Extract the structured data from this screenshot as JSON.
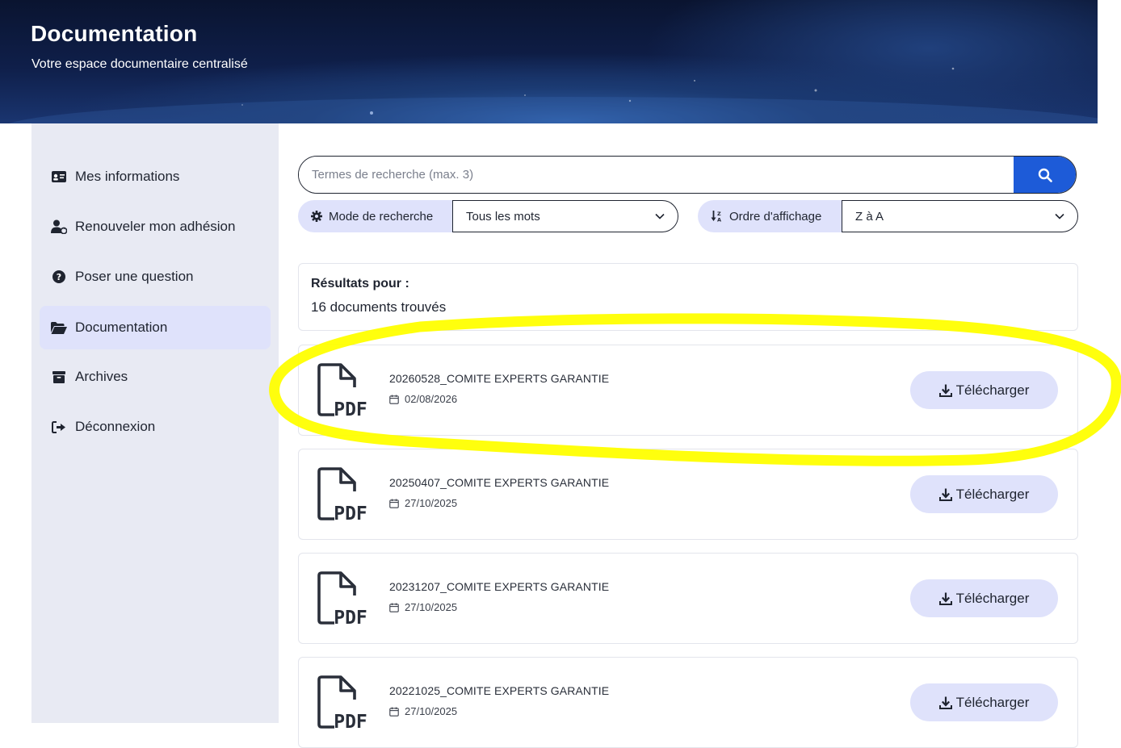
{
  "header": {
    "title": "Documentation",
    "subtitle": "Votre espace documentaire centralisé"
  },
  "sidebar": {
    "items": [
      {
        "label": "Mes informations",
        "icon": "id-card-icon"
      },
      {
        "label": "Renouveler mon adhésion",
        "icon": "user-refresh-icon"
      },
      {
        "label": "Poser une question",
        "icon": "question-circle-icon"
      },
      {
        "label": "Documentation",
        "icon": "folder-open-icon",
        "active": true
      },
      {
        "label": "Archives",
        "icon": "archive-box-icon"
      },
      {
        "label": "Déconnexion",
        "icon": "sign-out-icon"
      }
    ]
  },
  "search": {
    "placeholder": "Termes de recherche (max. 3)",
    "value": ""
  },
  "filters": {
    "mode_label": "Mode de recherche",
    "mode_value": "Tous les mots",
    "order_label": "Ordre d'affichage",
    "order_value": "Z à A"
  },
  "results": {
    "title": "Résultats pour :",
    "count_text": "16 documents trouvés"
  },
  "documents": [
    {
      "name": "20260528_COMITE EXPERTS GARANTIE",
      "date": "02/08/2026",
      "download_label": "Télécharger",
      "highlighted": true
    },
    {
      "name": "20250407_COMITE EXPERTS GARANTIE",
      "date": "27/10/2025",
      "download_label": "Télécharger"
    },
    {
      "name": "20231207_COMITE EXPERTS GARANTIE",
      "date": "27/10/2025",
      "download_label": "Télécharger"
    },
    {
      "name": "20221025_COMITE EXPERTS GARANTIE",
      "date": "27/10/2025",
      "download_label": "Télécharger"
    }
  ],
  "colors": {
    "accent": "#1d5bd8",
    "chip": "#dfe2fb",
    "sidebar_bg": "#e8eaf3",
    "highlight": "#ffff00"
  }
}
